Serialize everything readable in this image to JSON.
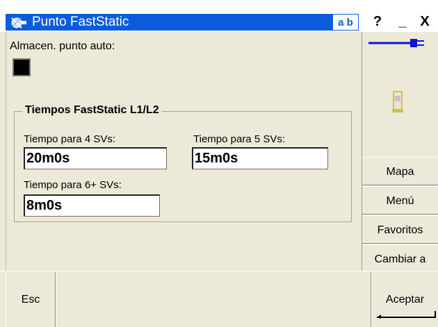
{
  "window": {
    "title": "Punto FastStatic",
    "input_mode": "a b",
    "help_label": "?",
    "minimize_label": "_",
    "close_label": "X",
    "title_color": "#0a5cdc"
  },
  "form": {
    "auto_store_label": "Almacen. punto auto:",
    "auto_store_checked": true,
    "group_title": "Tiempos FastStatic L1/L2",
    "fields": {
      "svs4": {
        "label": "Tiempo para  4 SVs:",
        "value": "20m0s"
      },
      "svs5": {
        "label": "Tiempo para 5 SVs:",
        "value": "15m0s"
      },
      "svs6": {
        "label": "Tiempo para 6+ SVs:",
        "value": "8m0s"
      }
    }
  },
  "side_buttons": {
    "map": "Mapa",
    "menu": "Menú",
    "favorites": "Favoritos",
    "switch": "Cambiar a"
  },
  "bottom": {
    "esc": "Esc",
    "accept": "Aceptar"
  }
}
